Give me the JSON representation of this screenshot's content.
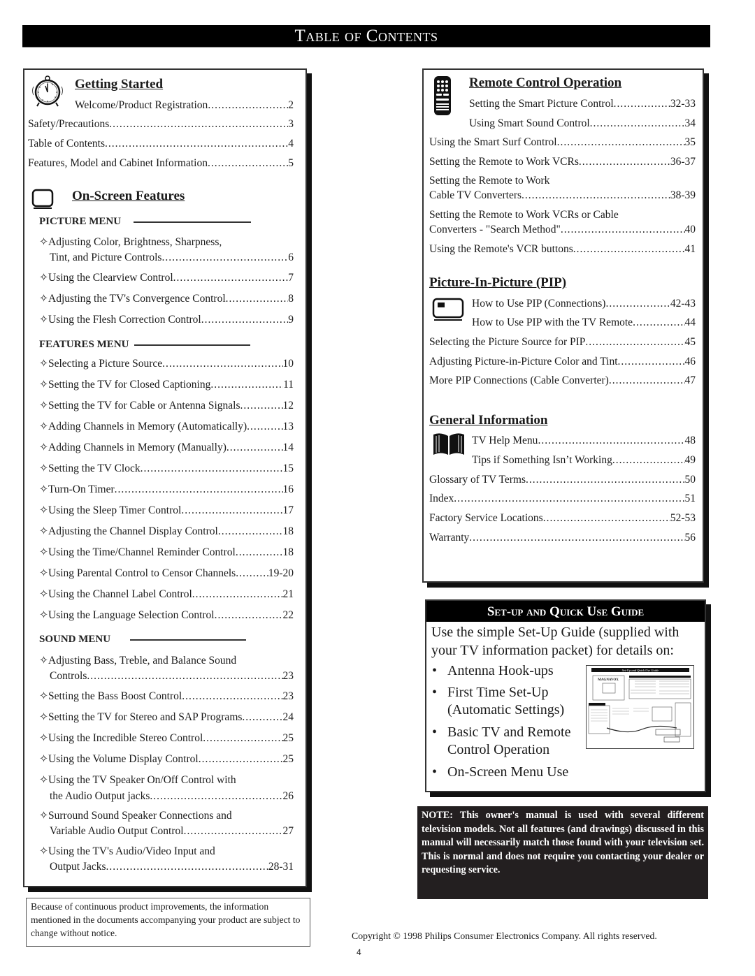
{
  "page_title": "Table of Contents",
  "getting_started": {
    "heading": "Getting Started",
    "entries": [
      {
        "title": "Welcome/Product Registration",
        "page": "2"
      },
      {
        "title": "Safety/Precautions",
        "page": "3"
      },
      {
        "title": "Table of Contents",
        "page": "4"
      },
      {
        "title": "Features, Model and Cabinet Information",
        "page": "5"
      }
    ]
  },
  "on_screen_features": {
    "heading": "On-Screen Features",
    "picture_menu": {
      "label": "PICTURE MENU",
      "entries": [
        {
          "line1": "Adjusting Color, Brightness, Sharpness,",
          "title": "Tint, and Picture Controls",
          "page": "6"
        },
        {
          "title": "Using the Clearview Control",
          "page": "7"
        },
        {
          "title": "Adjusting the TV's Convergence Control",
          "page": "8"
        },
        {
          "title": "Using the Flesh Correction Control",
          "page": "9"
        }
      ]
    },
    "features_menu": {
      "label": "FEATURES MENU",
      "entries": [
        {
          "title": "Selecting a Picture Source",
          "page": "10"
        },
        {
          "title": "Setting the TV for Closed Captioning",
          "page": "11"
        },
        {
          "title": "Setting the TV for Cable or Antenna Signals",
          "page": "12"
        },
        {
          "title": "Adding Channels in Memory (Automatically)",
          "page": "13"
        },
        {
          "title": "Adding Channels in Memory (Manually)",
          "page": "14"
        },
        {
          "title": "Setting the TV Clock",
          "page": "15"
        },
        {
          "title": "Turn-On Timer",
          "page": "16"
        },
        {
          "title": "Using the Sleep Timer Control",
          "page": "17"
        },
        {
          "title": "Adjusting the Channel Display Control",
          "page": "18"
        },
        {
          "title": "Using the Time/Channel Reminder Control",
          "page": "18"
        },
        {
          "title": "Using Parental Control to Censor Channels",
          "page": "19-20"
        },
        {
          "title": "Using the Channel Label Control",
          "page": "21"
        },
        {
          "title": "Using the Language Selection Control",
          "page": "22"
        }
      ]
    },
    "sound_menu": {
      "label": "SOUND MENU",
      "entries": [
        {
          "line1": "Adjusting Bass, Treble, and Balance Sound",
          "title": "Controls",
          "page": "23"
        },
        {
          "title": "Setting the Bass Boost Control",
          "page": "23"
        },
        {
          "title": "Setting the TV for Stereo and SAP Programs",
          "page": "24"
        },
        {
          "title": "Using the Incredible Stereo Control",
          "page": "25"
        },
        {
          "title": "Using the Volume Display Control",
          "page": "25"
        },
        {
          "line1": "Using the TV Speaker On/Off Control with",
          "title": "the Audio Output jacks",
          "page": "26"
        },
        {
          "line1": "Surround Sound Speaker Connections and",
          "title": "Variable Audio Output Control",
          "page": "27"
        },
        {
          "line1": "Using the TV's Audio/Video Input and",
          "title": "Output Jacks",
          "page": "28-31"
        }
      ]
    }
  },
  "remote_control": {
    "heading": "Remote Control Operation",
    "entries": [
      {
        "title": "Setting the Smart Picture Control",
        "page": "32-33"
      },
      {
        "title": "Using Smart Sound Control",
        "page": "34"
      },
      {
        "title": "Using the Smart Surf Control",
        "page": "35"
      },
      {
        "title": "Setting the Remote to Work VCRs",
        "page": "36-37"
      },
      {
        "line1": "Setting the Remote to Work",
        "title": "Cable TV Converters",
        "page": "38-39"
      },
      {
        "line1": "Setting the Remote to Work VCRs or Cable",
        "title": "Converters - \"Search Method\"",
        "page": "40"
      },
      {
        "title": "Using the Remote's VCR buttons",
        "page": "41"
      }
    ]
  },
  "pip": {
    "heading": "Picture-In-Picture (PIP)",
    "entries": [
      {
        "title": "How to Use PIP (Connections)",
        "page": "42-43"
      },
      {
        "title": "How to Use PIP with the TV Remote",
        "page": "44"
      },
      {
        "title": "Selecting the Picture Source for PIP",
        "page": "45"
      },
      {
        "title": "Adjusting Picture-in-Picture Color and Tint",
        "page": "46"
      },
      {
        "title": "More PIP Connections (Cable Converter)",
        "page": "47"
      }
    ]
  },
  "general_info": {
    "heading": "General Information",
    "entries": [
      {
        "title": "TV Help Menu",
        "page": "48"
      },
      {
        "title": "Tips if Something Isn’t Working",
        "page": "49"
      },
      {
        "title": "Glossary of TV Terms",
        "page": "50"
      },
      {
        "title": "Index",
        "page": "51"
      },
      {
        "title": "Factory Service Locations",
        "page": "52-53"
      },
      {
        "title": "Warranty",
        "page": "56"
      }
    ]
  },
  "setup_guide": {
    "heading": "Set-up and Quick Use Guide",
    "intro_line1": "Use the simple Set-Up Guide (supplied with",
    "intro_line2": "your TV information packet) for details on:",
    "bullet_char": "•",
    "bullets": [
      {
        "line1": "Antenna Hook-ups"
      },
      {
        "line1": "First Time Set-Up",
        "line2": "(Automatic Settings)"
      },
      {
        "line1": "Basic TV and Remote",
        "line2": "Control Operation"
      },
      {
        "line1": "On-Screen Menu Use"
      }
    ],
    "thumbnail_title": "Set-Up and Quick Use Guide",
    "thumbnail_brand": "MAGNAVOX"
  },
  "note": "NOTE: This owner's manual is used with several different television models.  Not all features (and drawings) discussed in this manual will necessarily match those found with your television set. This is normal and does not require you contacting your dealer or requesting service.",
  "disclaimer": "Because of continuous product improvements, the information mentioned in the documents accompanying your product are subject to change without notice.",
  "copyright": "Copyright © 1998 Philips Consumer Electronics Company. All rights reserved.",
  "page_number": "4",
  "diamond_bullet": "✧"
}
